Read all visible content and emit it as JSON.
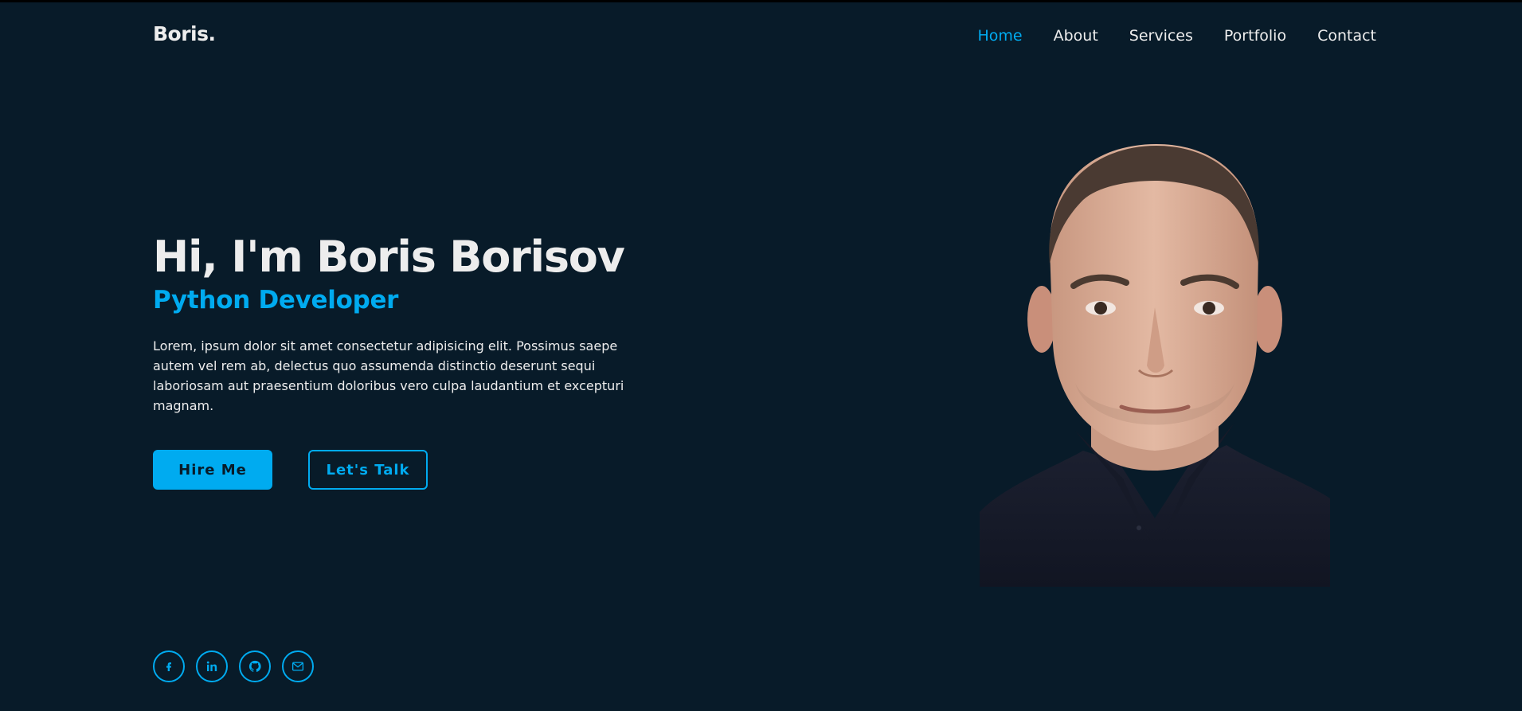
{
  "header": {
    "logo": "Boris.",
    "nav": [
      {
        "label": "Home",
        "active": true
      },
      {
        "label": "About",
        "active": false
      },
      {
        "label": "Services",
        "active": false
      },
      {
        "label": "Portfolio",
        "active": false
      },
      {
        "label": "Contact",
        "active": false
      }
    ]
  },
  "hero": {
    "title": "Hi, I'm Boris Borisov",
    "subtitle": "Python Developer",
    "description": "Lorem, ipsum dolor sit amet consectetur adipisicing elit. Possimus saepe autem vel rem ab, delectus quo assumenda distinctio deserunt sequi laboriosam aut praesentium doloribus vero culpa laudantium et excepturi magnam.",
    "buttons": {
      "primary": "Hire Me",
      "secondary": "Let's Talk"
    }
  },
  "socials": [
    {
      "icon": "facebook-icon"
    },
    {
      "icon": "linkedin-icon"
    },
    {
      "icon": "github-icon"
    },
    {
      "icon": "mail-icon"
    }
  ],
  "colors": {
    "background": "#081b29",
    "accent": "#00abf0",
    "text": "#ededed"
  }
}
